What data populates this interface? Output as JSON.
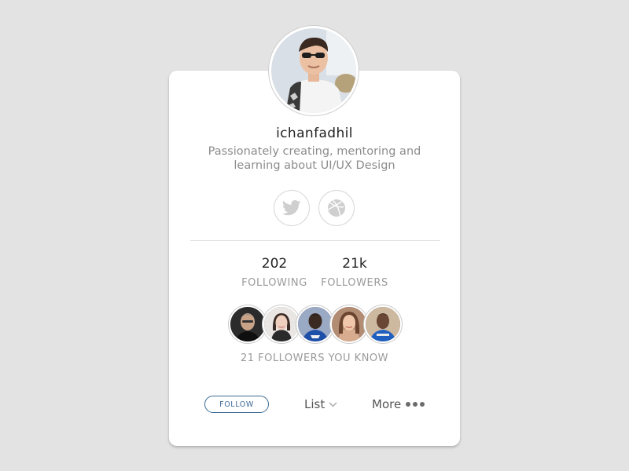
{
  "profile": {
    "username": "ichanfadhil",
    "bio_line1": "Passionately creating, mentoring and",
    "bio_line2": "learning about UI/UX Design"
  },
  "social": [
    {
      "icon": "twitter-icon"
    },
    {
      "icon": "dribbble-icon"
    }
  ],
  "stats": {
    "following_value": "202",
    "following_label": "FOLLOWING",
    "followers_value": "21k",
    "followers_label": "FOLLOWERS"
  },
  "followers_you_know": {
    "label": "21 FOLLOWERS YOU KNOW",
    "avatars": [
      "avatar-1",
      "avatar-2",
      "avatar-3",
      "avatar-4",
      "avatar-5"
    ]
  },
  "actions": {
    "follow_label": "FOLLOW",
    "list_label": "List",
    "more_label": "More"
  },
  "colors": {
    "background": "#e3e3e3",
    "card": "#ffffff",
    "follow_accent": "#3e6b96",
    "muted_text": "#9a9a9a"
  }
}
